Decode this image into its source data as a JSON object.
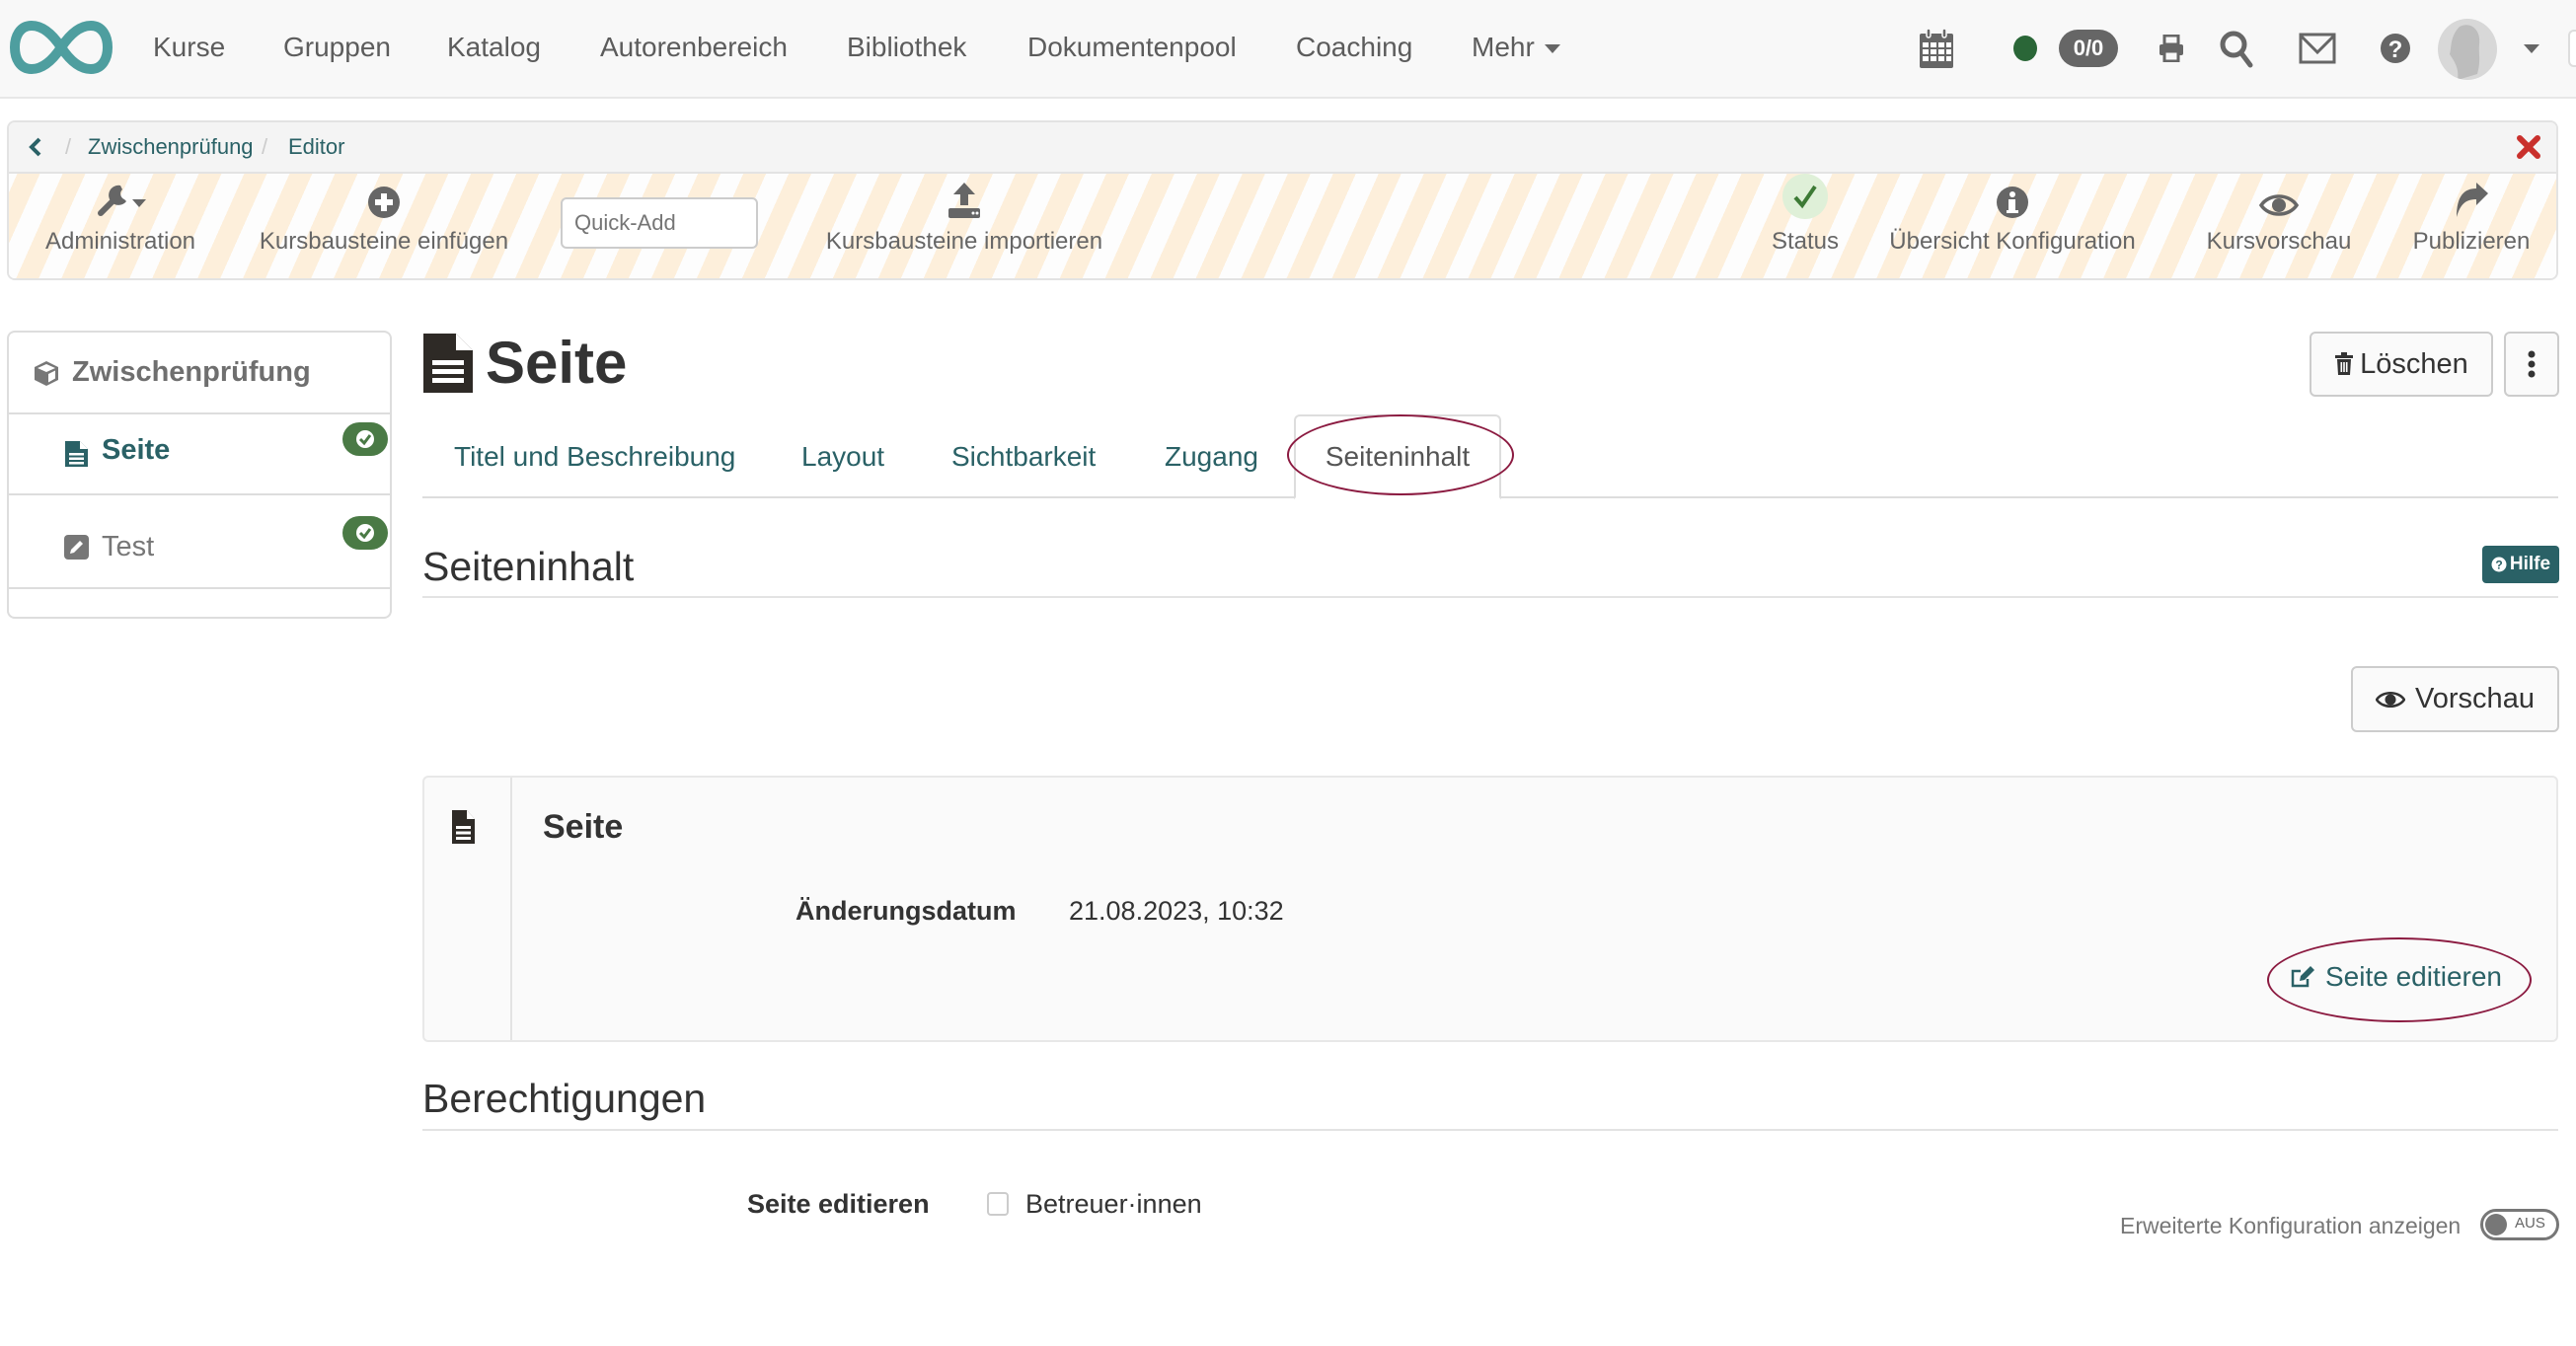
{
  "nav": {
    "logo": "infinity-logo",
    "items": [
      "Kurse",
      "Gruppen",
      "Katalog",
      "Autorenbereich",
      "Bibliothek",
      "Dokumentenpool",
      "Coaching",
      "Mehr"
    ],
    "counter": "0/0",
    "icons": [
      "calendar-icon",
      "status-dot",
      "print-icon",
      "search-icon",
      "mail-icon",
      "help-icon",
      "avatar"
    ]
  },
  "breadcrumb": {
    "items": [
      "Zwischenprüfung",
      "Editor"
    ]
  },
  "toolbar": {
    "administration": "Administration",
    "insert_nodes": "Kursbausteine einfügen",
    "quick_add_placeholder": "Quick-Add",
    "import_nodes": "Kursbausteine importieren",
    "status": "Status",
    "overview": "Übersicht Konfiguration",
    "preview": "Kursvorschau",
    "publish": "Publizieren"
  },
  "sidebar": {
    "root": "Zwischenprüfung",
    "items": [
      {
        "label": "Seite",
        "active": true,
        "status": "ok"
      },
      {
        "label": "Test",
        "active": false,
        "status": "ok"
      }
    ]
  },
  "main": {
    "title": "Seite",
    "delete_label": "Löschen",
    "tabs": [
      {
        "label": "Titel und Beschreibung",
        "active": false
      },
      {
        "label": "Layout",
        "active": false
      },
      {
        "label": "Sichtbarkeit",
        "active": false
      },
      {
        "label": "Zugang",
        "active": false
      },
      {
        "label": "Seiteninhalt",
        "active": true
      }
    ],
    "section_content": "Seiteninhalt",
    "help_label": "Hilfe",
    "preview_label": "Vorschau",
    "panel": {
      "title": "Seite",
      "date_label": "Änderungsdatum",
      "date_value": "21.08.2023, 10:32",
      "edit_label": "Seite editieren"
    },
    "section_permissions": "Berechtigungen",
    "permissions": {
      "label": "Seite editieren",
      "option": "Betreuer·innen",
      "checked": false
    },
    "advanced": {
      "label": "Erweiterte Konfiguration anzeigen",
      "toggle_text": "AUS"
    }
  },
  "colors": {
    "accent": "#2a6166",
    "status_green": "#2a6637",
    "badge_green": "#4a7a45",
    "highlight_ellipse": "#8b1a40",
    "stripe_orange": "#fdefdb",
    "close_red": "#c9302c"
  }
}
